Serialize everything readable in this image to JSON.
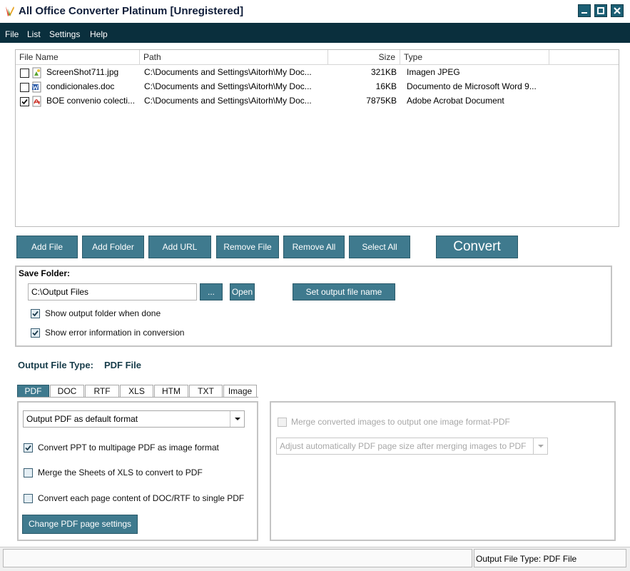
{
  "window": {
    "title": "All Office Converter Platinum [Unregistered]",
    "controls": [
      "minimize-icon",
      "maximize-icon",
      "close-icon"
    ]
  },
  "menu": {
    "items": [
      "File",
      "List",
      "Settings",
      "Help"
    ]
  },
  "file_list": {
    "columns": [
      "File Name",
      "Path",
      "Size",
      "Type"
    ],
    "rows": [
      {
        "checked": false,
        "icon": "image-file-icon",
        "name": "ScreenShot711.jpg",
        "path": "C:\\Documents and Settings\\Aitorh\\My Doc...",
        "size": "321KB",
        "type": "Imagen JPEG"
      },
      {
        "checked": false,
        "icon": "word-file-icon",
        "name": "condicionales.doc",
        "path": "C:\\Documents and Settings\\Aitorh\\My Doc...",
        "size": "16KB",
        "type": "Documento de Microsoft Word 9..."
      },
      {
        "checked": true,
        "icon": "pdf-file-icon",
        "name": "BOE convenio colecti...",
        "path": "C:\\Documents and Settings\\Aitorh\\My Doc...",
        "size": "7875KB",
        "type": "Adobe Acrobat Document"
      }
    ]
  },
  "toolbar": {
    "add_file": "Add File",
    "add_folder": "Add Folder",
    "add_url": "Add URL",
    "remove_file": "Remove File",
    "remove_all": "Remove All",
    "select_all": "Select All",
    "convert": "Convert"
  },
  "save_folder": {
    "title": "Save Folder:",
    "path": "C:\\Output Files",
    "browse": "...",
    "open": "Open",
    "set_output_name": "Set output file name",
    "show_output_folder": {
      "label": "Show output folder when done",
      "checked": true
    },
    "show_error_info": {
      "label": "Show error information in conversion",
      "checked": true
    }
  },
  "output_type": {
    "label": "Output File Type:",
    "value": "PDF File"
  },
  "tabs": [
    "PDF",
    "DOC",
    "RTF",
    "XLS",
    "HTM",
    "TXT",
    "Image"
  ],
  "active_tab": "PDF",
  "pdf_options": {
    "format_select": "Output PDF as default format",
    "ppt_multipage": {
      "label": "Convert PPT to multipage PDF as image format",
      "checked": true
    },
    "merge_xls": {
      "label": "Merge the Sheets of XLS to convert to PDF",
      "checked": false
    },
    "doc_single": {
      "label": "Convert each page content of DOC/RTF to single PDF",
      "checked": false
    },
    "page_settings": "Change PDF page settings"
  },
  "image_options": {
    "merge_images": {
      "label": "Merge converted images to output one image format-PDF",
      "checked": false,
      "enabled": false
    },
    "page_size_select": "Adjust automatically PDF page size after merging images to PDF"
  },
  "status": {
    "left": "",
    "right": "Output File Type:  PDF File"
  },
  "colors": {
    "menubar": "#0a2f3d",
    "button": "#3f7a8e",
    "accent_dark": "#173c4a"
  }
}
